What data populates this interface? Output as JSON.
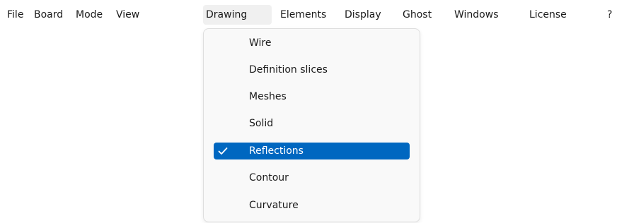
{
  "menubar": {
    "items": [
      {
        "label": "File"
      },
      {
        "label": "Board"
      },
      {
        "label": "Mode"
      },
      {
        "label": "View"
      },
      {
        "label": "Drawing",
        "active": true
      },
      {
        "label": "Elements"
      },
      {
        "label": "Display"
      },
      {
        "label": "Ghost"
      },
      {
        "label": "Windows"
      },
      {
        "label": "License"
      },
      {
        "label": "?"
      }
    ]
  },
  "drawing_menu": {
    "items": [
      {
        "label": "Wire",
        "checked": false
      },
      {
        "label": "Definition slices",
        "checked": false
      },
      {
        "label": "Meshes",
        "checked": false
      },
      {
        "label": "Solid",
        "checked": false
      },
      {
        "label": "Reflections",
        "checked": true,
        "highlighted": true
      },
      {
        "label": "Contour",
        "checked": false
      },
      {
        "label": "Curvature",
        "checked": false
      }
    ]
  },
  "colors": {
    "highlight": "#0067c0",
    "menu_background": "#f9f9f9",
    "active_menubar_item": "#f0f0f0"
  },
  "icons": {
    "check": "checkmark-icon"
  }
}
